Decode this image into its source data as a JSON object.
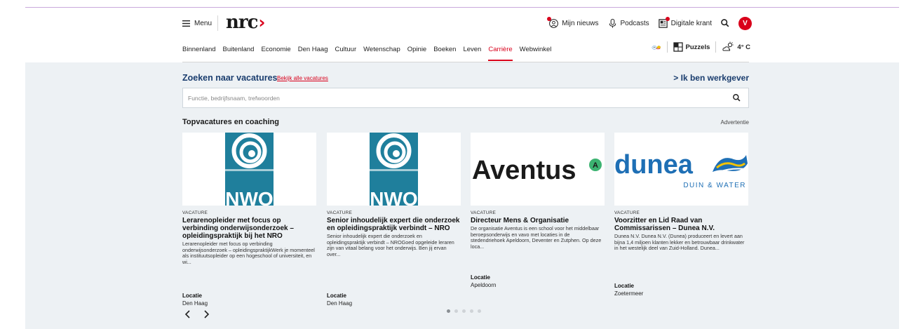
{
  "header": {
    "menu_label": "Menu",
    "logo_text": "nrc",
    "links": {
      "mijn_nieuws": "Mijn nieuws",
      "podcasts": "Podcasts",
      "digitale_krant": "Digitale krant"
    },
    "avatar_initial": "V"
  },
  "nav": {
    "items": [
      "Binnenland",
      "Buitenland",
      "Economie",
      "Den Haag",
      "Cultuur",
      "Wetenschap",
      "Opinie",
      "Boeken",
      "Leven",
      "Carrière",
      "Webwinkel"
    ],
    "active_index": 9,
    "puzzels_label": "Puzzels",
    "weather": "4° C"
  },
  "search": {
    "title": "Zoeken naar vacatures",
    "all_link": "Bekijk alle vacatures",
    "employer_link": "> Ik ben werkgever",
    "placeholder": "Functie, bedrijfsnaam, trefwoorden"
  },
  "section": {
    "title": "Topvacatures en coaching",
    "ad_label": "Advertentie"
  },
  "cards": [
    {
      "logo_text": "NWO",
      "kicker": "VACATURE",
      "title": "Lerarenopleider met focus op verbinding onderwijsonderzoek – opleidingspraktijk bij het NRO",
      "desc": "Lerarenopleider met focus op verbinding onderwijsonderzoek – opleidingspraktijkWerk je momenteel als instituutsopleider op een hogeschool of universiteit, en wi...",
      "loc_label": "Locatie",
      "loc": "Den Haag"
    },
    {
      "logo_text": "NWO",
      "kicker": "VACATURE",
      "title": "Senior inhoudelijk expert die onderzoek en opleidingspraktijk verbindt – NRO",
      "desc": "Senior inhoudelijk expert die onderzoek en opleidingspraktijk verbindt – NROGoed opgeleide leraren zijn van vitaal belang voor het onderwijs. Ben jij ervan over...",
      "loc_label": "Locatie",
      "loc": "Den Haag"
    },
    {
      "logo_text": "Aventus",
      "logo_badge": "A",
      "kicker": "VACATURE",
      "title": "Directeur Mens & Organisatie",
      "desc": "De organisatie Aventus is een school voor het middelbaar beroepsonderwijs en vavo met locaties in de stedendriehoek Apeldoorn, Deventer en Zutphen. Op deze loca...",
      "loc_label": "Locatie",
      "loc": "Apeldoorn"
    },
    {
      "logo_text": "dunea",
      "logo_sub": "DUIN & WATER",
      "kicker": "VACATURE",
      "title": "Voorzitter en Lid Raad van Commissarissen – Dunea N.V.",
      "desc": "Dunea N.V. Dunea N.V. (Dunea) produceert en levert aan bijna 1,4 miljoen klanten lekker en betrouwbaar drinkwater in het westelijk deel van Zuid-Holland. Dunea...",
      "loc_label": "Locatie",
      "loc": "Zoetermeer"
    }
  ],
  "carousel": {
    "dot_count": 5,
    "active_dot": 0
  },
  "colors": {
    "brand_red": "#d9001b",
    "link_blue": "#1a3d6e",
    "page_bg": "#edf1f4",
    "nwo_teal": "#1f7f9c",
    "aventus_green": "#3cb371",
    "dunea_blue": "#1e6fb5",
    "dunea_yellow": "#f2c200"
  }
}
